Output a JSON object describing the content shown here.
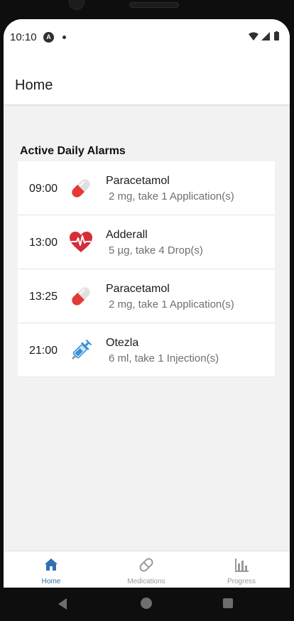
{
  "status_bar": {
    "time": "10:10",
    "launcher_badge": "A"
  },
  "app_bar": {
    "title": "Home"
  },
  "alarms_section": {
    "title": "Active Daily Alarms",
    "items": [
      {
        "time": "09:00",
        "name": "Paracetamol",
        "detail": "2 mg, take 1 Application(s)",
        "icon": "pill-capsule-icon"
      },
      {
        "time": "13:00",
        "name": "Adderall",
        "detail": "5 µg, take 4 Drop(s)",
        "icon": "heart-pulse-icon"
      },
      {
        "time": "13:25",
        "name": "Paracetamol",
        "detail": "2 mg, take 1 Application(s)",
        "icon": "pill-capsule-icon"
      },
      {
        "time": "21:00",
        "name": "Otezla",
        "detail": "6 ml, take 1 Injection(s)",
        "icon": "syringe-icon"
      }
    ]
  },
  "bottom_nav": {
    "items": [
      {
        "label": "Home",
        "icon": "home-icon",
        "active": true
      },
      {
        "label": "Medications",
        "icon": "pill-outline-icon",
        "active": false
      },
      {
        "label": "Progress",
        "icon": "bar-chart-icon",
        "active": false
      }
    ]
  },
  "colors": {
    "accent": "#2f6fb3",
    "pill_red": "#e53935",
    "heart_red": "#d32f3a",
    "syringe_blue": "#3b8fd6"
  }
}
